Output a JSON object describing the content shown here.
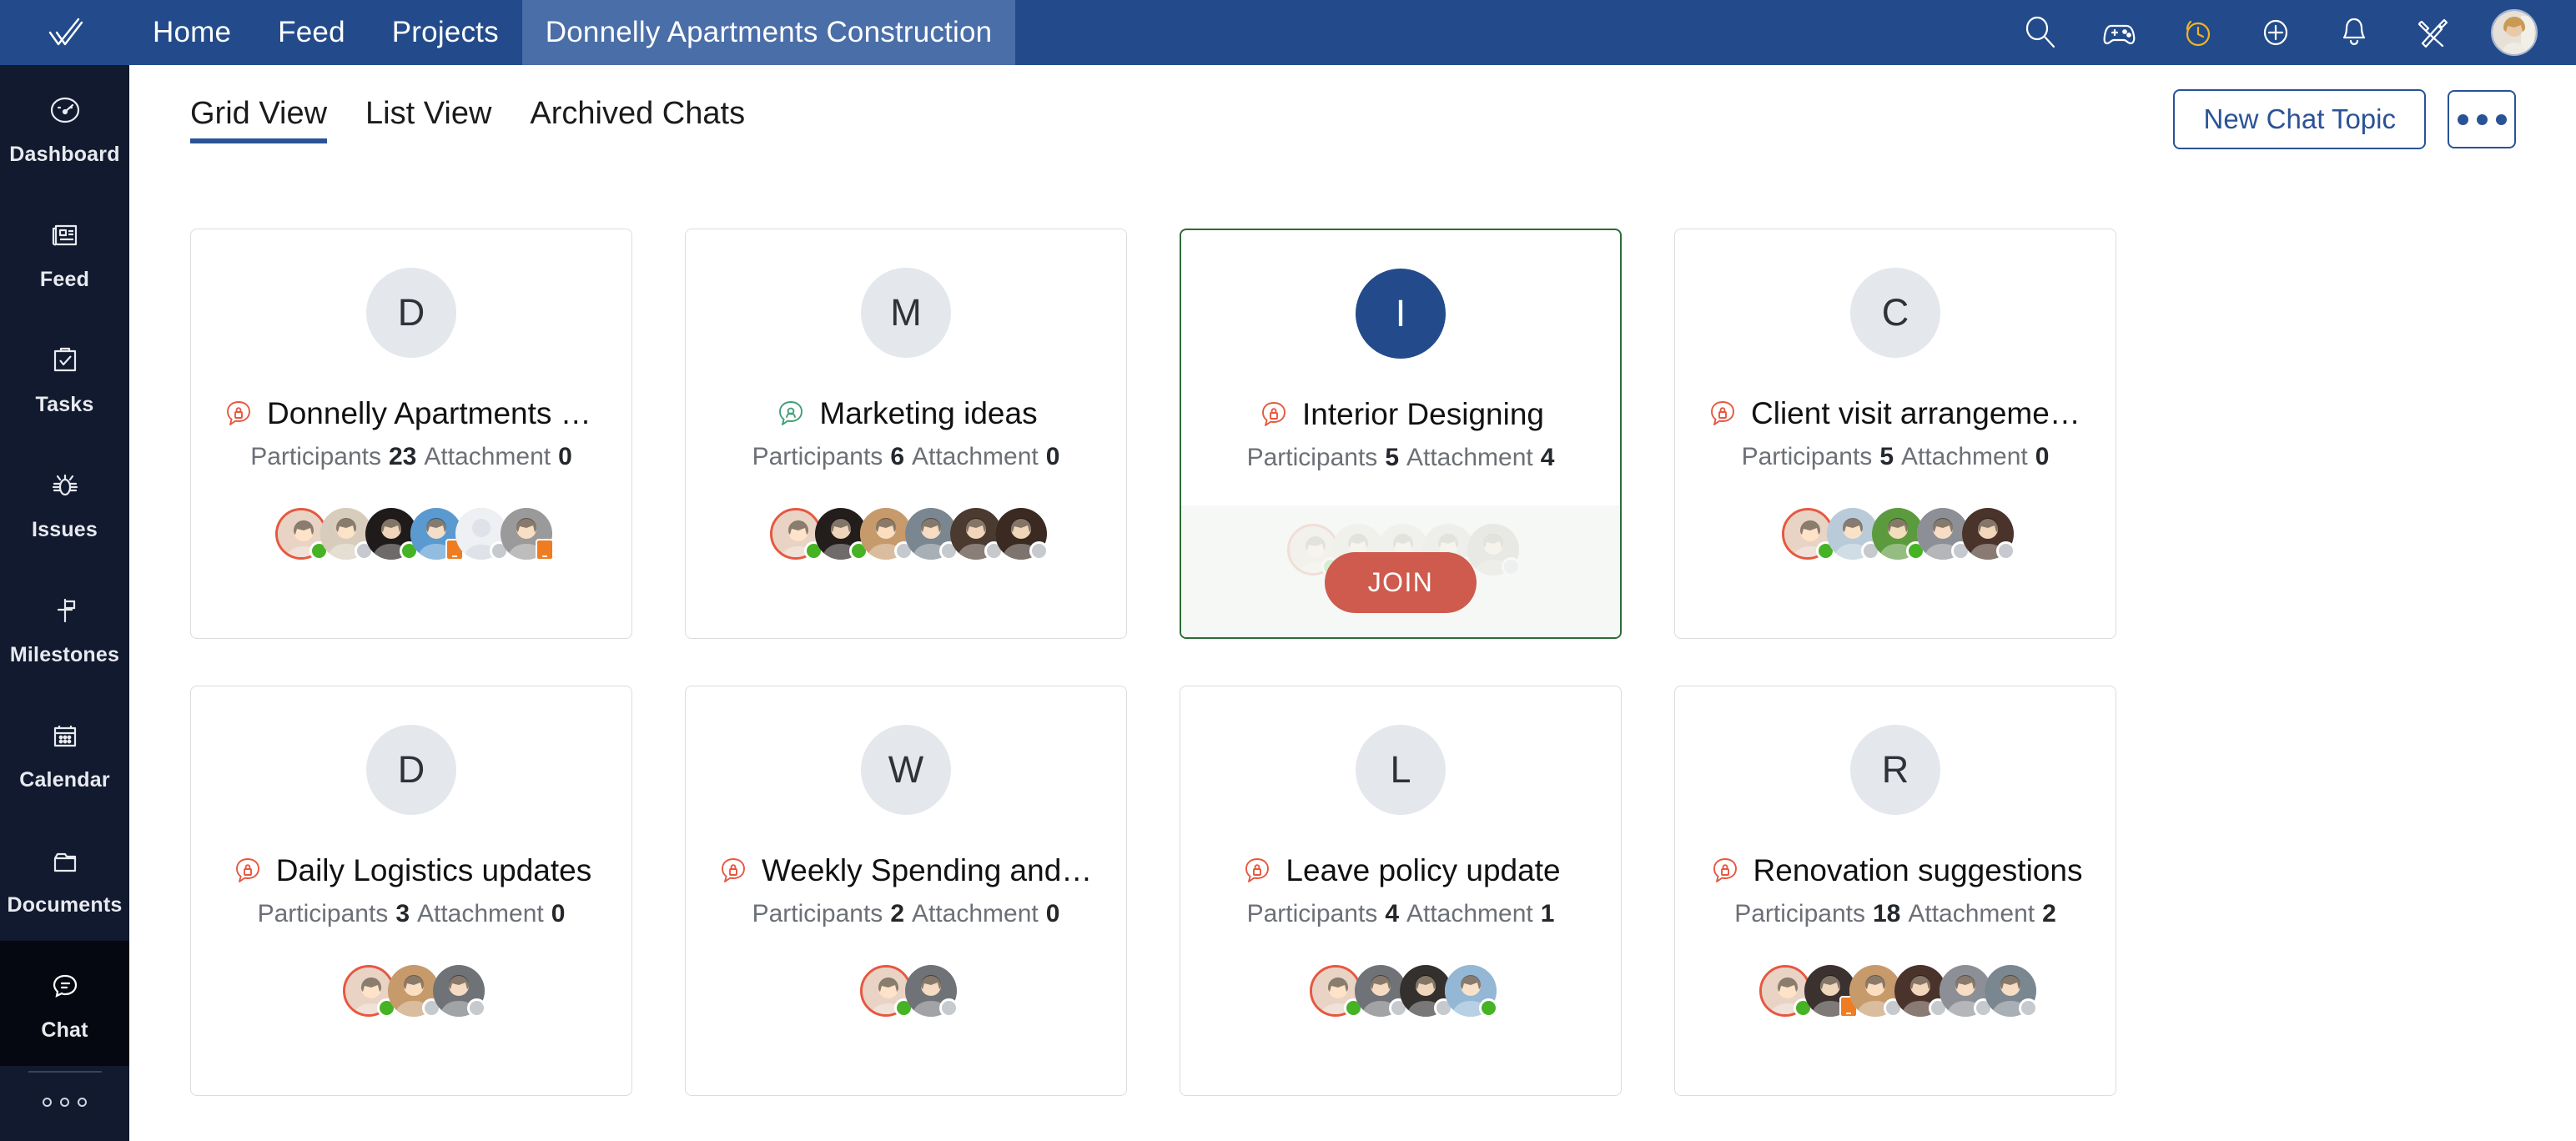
{
  "topbar": {
    "logo_icon": "double-check-logo",
    "nav": [
      {
        "label": "Home",
        "active": false
      },
      {
        "label": "Feed",
        "active": false
      },
      {
        "label": "Projects",
        "active": false
      },
      {
        "label": "Donnelly Apartments Construction",
        "active": true
      }
    ],
    "icons": [
      {
        "name": "search-icon"
      },
      {
        "name": "game-controller-icon"
      },
      {
        "name": "timer-clock-icon"
      },
      {
        "name": "add-plus-icon"
      },
      {
        "name": "notification-bell-icon"
      },
      {
        "name": "tools-icon"
      }
    ],
    "avatar_name": "user-avatar"
  },
  "sidebar": {
    "items": [
      {
        "label": "Dashboard",
        "icon": "gauge-icon",
        "active": false
      },
      {
        "label": "Feed",
        "icon": "newspaper-icon",
        "active": false
      },
      {
        "label": "Tasks",
        "icon": "clipboard-check-icon",
        "active": false
      },
      {
        "label": "Issues",
        "icon": "bug-icon",
        "active": false
      },
      {
        "label": "Milestones",
        "icon": "flag-icon",
        "active": false
      },
      {
        "label": "Calendar",
        "icon": "calendar-icon",
        "active": false
      },
      {
        "label": "Documents",
        "icon": "folder-icon",
        "active": false
      },
      {
        "label": "Chat",
        "icon": "chat-bubble-icon",
        "active": true
      }
    ],
    "more_icon": "more-dots-icon"
  },
  "subheader": {
    "tabs": [
      {
        "label": "Grid View",
        "active": true
      },
      {
        "label": "List View",
        "active": false
      },
      {
        "label": "Archived Chats",
        "active": false
      }
    ],
    "new_chat_label": "New Chat Topic",
    "more_icon": "more-dots-icon"
  },
  "labels": {
    "participants": "Participants",
    "attachment": "Attachment",
    "join": "JOIN"
  },
  "colors": {
    "topbar": "#234b8b",
    "topbar_active_tab": "#4a6ea8",
    "sidebar": "#111a2e",
    "sidebar_active": "#050811",
    "accent_blue": "#2a5296",
    "private_icon": "#e8573f",
    "public_icon": "#3f9e77",
    "hover_border": "#2d6b37",
    "join_button": "#cf5a4e",
    "status_online": "#46b324",
    "status_offline": "#c6c9ce",
    "status_mobile": "#f07c22"
  },
  "cards": [
    {
      "initial": "D",
      "title": "Donnelly Apartments C...",
      "privacy": "private",
      "participants": 23,
      "attachments": 0,
      "hovered": false,
      "avatars": [
        {
          "kind": "photo",
          "tone": "#e8d3c4",
          "status": "online",
          "me": true
        },
        {
          "kind": "photo",
          "tone": "#d8cdbc",
          "status": "offline",
          "me": false
        },
        {
          "kind": "photo",
          "tone": "#1f1b1a",
          "status": "online",
          "me": false
        },
        {
          "kind": "photo",
          "tone": "#5a9ad0",
          "status": "mobile",
          "me": false
        },
        {
          "kind": "placeholder",
          "tone": "#dde0e6",
          "status": "offline",
          "me": false
        },
        {
          "kind": "photo",
          "tone": "#9a9a9a",
          "status": "mobile",
          "me": false
        }
      ]
    },
    {
      "initial": "M",
      "title": "Marketing ideas",
      "privacy": "public",
      "participants": 6,
      "attachments": 0,
      "hovered": false,
      "avatars": [
        {
          "kind": "photo",
          "tone": "#e8d3c4",
          "status": "online",
          "me": true
        },
        {
          "kind": "photo",
          "tone": "#231d1c",
          "status": "online",
          "me": false
        },
        {
          "kind": "photo",
          "tone": "#c79a6b",
          "status": "offline",
          "me": false
        },
        {
          "kind": "photo",
          "tone": "#7a8690",
          "status": "offline",
          "me": false
        },
        {
          "kind": "photo",
          "tone": "#4a3a30",
          "status": "offline",
          "me": false
        },
        {
          "kind": "photo",
          "tone": "#3a2a22",
          "status": "offline",
          "me": false
        }
      ]
    },
    {
      "initial": "I",
      "title": "Interior Designing",
      "privacy": "private",
      "participants": 5,
      "attachments": 4,
      "hovered": true,
      "avatars": [
        {
          "kind": "photo",
          "tone": "#e8d3c4",
          "status": "online",
          "me": true
        },
        {
          "kind": "photo",
          "tone": "#ded0c2",
          "status": "offline",
          "me": false
        },
        {
          "kind": "photo",
          "tone": "#d9d2c8",
          "status": "offline",
          "me": false
        },
        {
          "kind": "photo",
          "tone": "#cfc6bd",
          "status": "offline",
          "me": false
        },
        {
          "kind": "photo",
          "tone": "#a89a8e",
          "status": "offline",
          "me": false
        }
      ]
    },
    {
      "initial": "C",
      "title": "Client visit arrangements",
      "privacy": "private",
      "participants": 5,
      "attachments": 0,
      "hovered": false,
      "avatars": [
        {
          "kind": "photo",
          "tone": "#e8d3c4",
          "status": "online",
          "me": true
        },
        {
          "kind": "photo",
          "tone": "#b9cbd8",
          "status": "offline",
          "me": false
        },
        {
          "kind": "photo",
          "tone": "#5c9a3e",
          "status": "online",
          "me": false
        },
        {
          "kind": "photo",
          "tone": "#8d8f96",
          "status": "offline",
          "me": false
        },
        {
          "kind": "photo",
          "tone": "#4a332a",
          "status": "offline",
          "me": false
        }
      ]
    },
    {
      "initial": "D",
      "title": "Daily Logistics updates",
      "privacy": "private",
      "participants": 3,
      "attachments": 0,
      "hovered": false,
      "avatars": [
        {
          "kind": "photo",
          "tone": "#e8d3c4",
          "status": "online",
          "me": true
        },
        {
          "kind": "photo",
          "tone": "#c79a6b",
          "status": "offline",
          "me": false
        },
        {
          "kind": "photo",
          "tone": "#6f7276",
          "status": "offline",
          "me": false
        }
      ]
    },
    {
      "initial": "W",
      "title": "Weekly Spending and B...",
      "privacy": "private",
      "participants": 2,
      "attachments": 0,
      "hovered": false,
      "avatars": [
        {
          "kind": "photo",
          "tone": "#e8d3c4",
          "status": "online",
          "me": true
        },
        {
          "kind": "photo",
          "tone": "#6f7276",
          "status": "offline",
          "me": false
        }
      ]
    },
    {
      "initial": "L",
      "title": "Leave policy update",
      "privacy": "private",
      "participants": 4,
      "attachments": 1,
      "hovered": false,
      "avatars": [
        {
          "kind": "photo",
          "tone": "#e8d3c4",
          "status": "online",
          "me": true
        },
        {
          "kind": "photo",
          "tone": "#6f7276",
          "status": "offline",
          "me": false
        },
        {
          "kind": "photo",
          "tone": "#33302e",
          "status": "offline",
          "me": false
        },
        {
          "kind": "photo",
          "tone": "#93b7d4",
          "status": "online",
          "me": false
        }
      ]
    },
    {
      "initial": "R",
      "title": "Renovation suggestions",
      "privacy": "private",
      "participants": 18,
      "attachments": 2,
      "hovered": false,
      "avatars": [
        {
          "kind": "photo",
          "tone": "#e8d3c4",
          "status": "online",
          "me": true
        },
        {
          "kind": "photo",
          "tone": "#3b3230",
          "status": "mobile",
          "me": false
        },
        {
          "kind": "photo",
          "tone": "#c79a6b",
          "status": "offline",
          "me": false
        },
        {
          "kind": "photo",
          "tone": "#4a332a",
          "status": "offline",
          "me": false
        },
        {
          "kind": "photo",
          "tone": "#8d8f96",
          "status": "offline",
          "me": false
        },
        {
          "kind": "photo",
          "tone": "#7a8690",
          "status": "offline",
          "me": false
        }
      ]
    }
  ]
}
